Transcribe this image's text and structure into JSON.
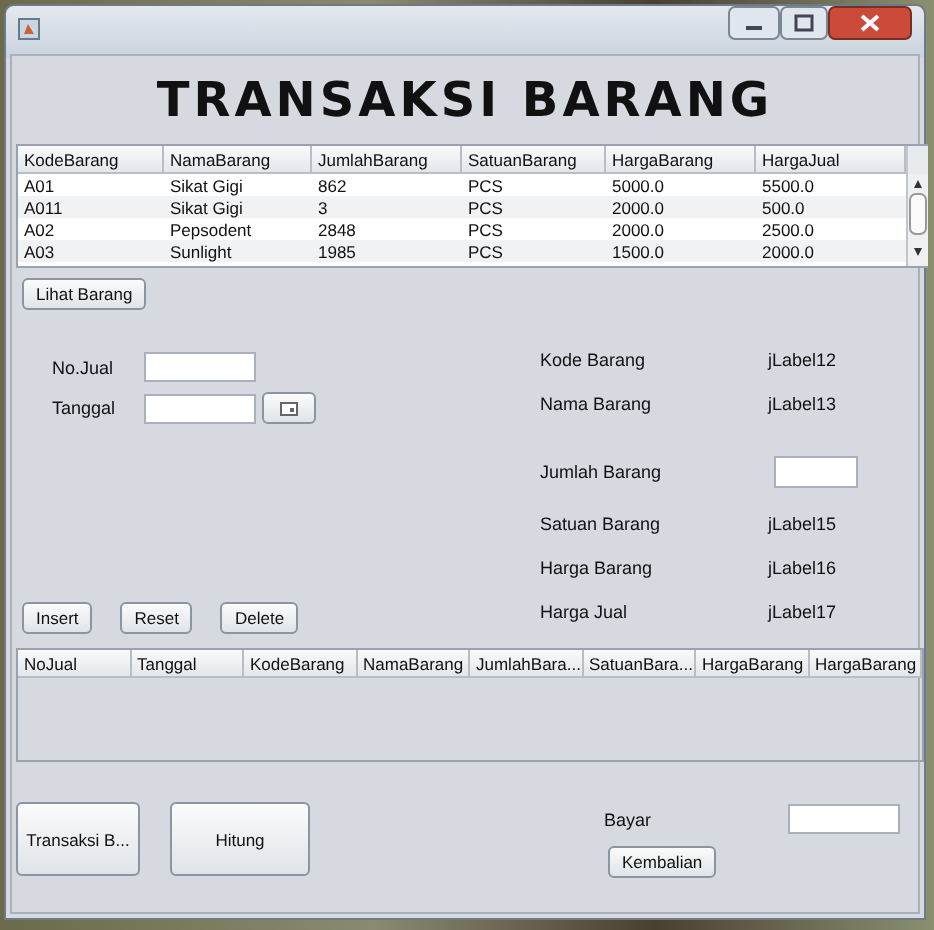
{
  "heading": "TRANSAKSI BARANG",
  "barang_table": {
    "columns": [
      "KodeBarang",
      "NamaBarang",
      "JumlahBarang",
      "SatuanBarang",
      "HargaBarang",
      "HargaJual"
    ],
    "rows": [
      [
        "A01",
        "Sikat Gigi",
        "862",
        "PCS",
        "5000.0",
        "5500.0"
      ],
      [
        "A011",
        "Sikat Gigi",
        "3",
        "PCS",
        "2000.0",
        "500.0"
      ],
      [
        "A02",
        "Pepsodent",
        "2848",
        "PCS",
        "2000.0",
        "2500.0"
      ],
      [
        "A03",
        "Sunlight",
        "1985",
        "PCS",
        "1500.0",
        "2000.0"
      ]
    ]
  },
  "lihat_button": "Lihat Barang",
  "form": {
    "no_jual_label": "No.Jual",
    "tanggal_label": "Tanggal"
  },
  "details": [
    {
      "label": "Kode Barang",
      "kind": "value",
      "value": "jLabel12"
    },
    {
      "label": "Nama Barang",
      "kind": "value",
      "value": "jLabel13"
    },
    {
      "label": "Jumlah Barang",
      "kind": "field"
    },
    {
      "label": "Satuan Barang",
      "kind": "value",
      "value": "jLabel15"
    },
    {
      "label": "Harga Barang",
      "kind": "value",
      "value": "jLabel16"
    },
    {
      "label": "Harga Jual",
      "kind": "value",
      "value": "jLabel17"
    }
  ],
  "action_buttons": [
    "Insert",
    "Reset",
    "Delete"
  ],
  "jual_table": {
    "columns": [
      "NoJual",
      "Tanggal",
      "KodeBarang",
      "NamaBarang",
      "JumlahBara...",
      "SatuanBara...",
      "HargaBarang",
      "HargaBarang"
    ]
  },
  "bottom_buttons": [
    "Transaksi B...",
    "Hitung"
  ],
  "bayar_label": "Bayar",
  "kembalian_button": "Kembalian"
}
